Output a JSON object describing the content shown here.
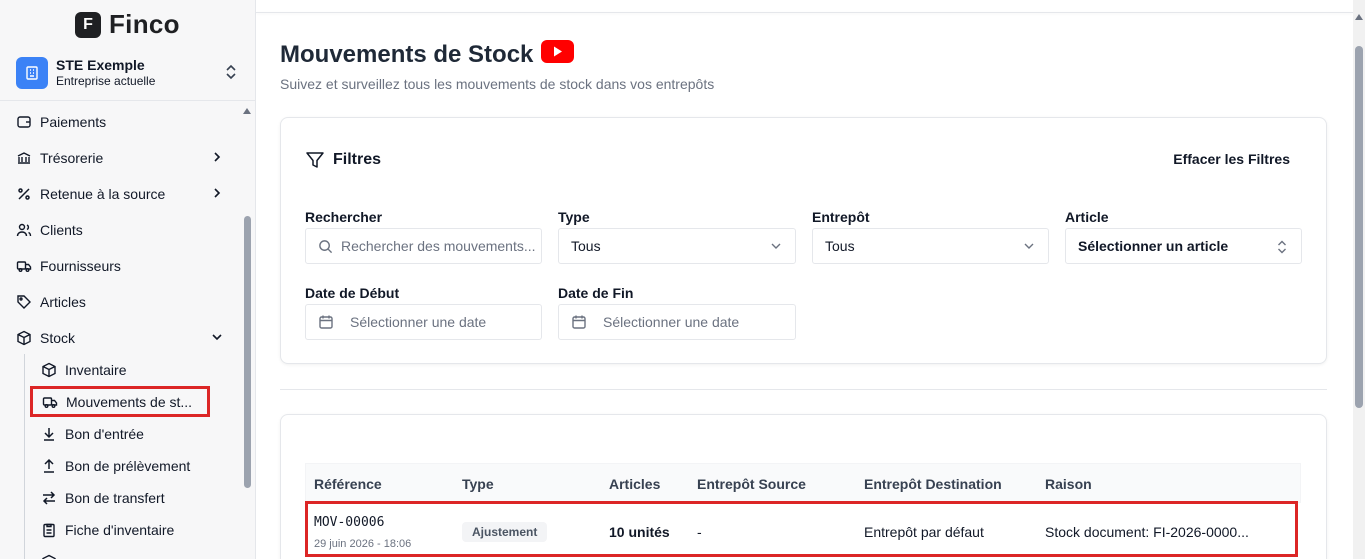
{
  "brand": {
    "logo_letter": "F",
    "name": "Finco"
  },
  "company": {
    "name": "STE Exemple",
    "subtitle": "Entreprise actuelle"
  },
  "sidebar": {
    "items": [
      {
        "label": "Paiements",
        "icon": "wallet-icon"
      },
      {
        "label": "Trésorerie",
        "icon": "bank-icon"
      },
      {
        "label": "Retenue à la source",
        "icon": "percent-icon"
      },
      {
        "label": "Clients",
        "icon": "users-icon"
      },
      {
        "label": "Fournisseurs",
        "icon": "truck-icon"
      },
      {
        "label": "Articles",
        "icon": "tag-icon"
      },
      {
        "label": "Stock",
        "icon": "box-icon"
      }
    ],
    "stock_sub": [
      {
        "label": "Inventaire",
        "icon": "box-icon"
      },
      {
        "label": "Mouvements de st...",
        "icon": "truck-icon"
      },
      {
        "label": "Bon d'entrée",
        "icon": "arrow-down-icon"
      },
      {
        "label": "Bon de prélèvement",
        "icon": "arrow-up-icon"
      },
      {
        "label": "Bon de transfert",
        "icon": "transfer-icon"
      },
      {
        "label": "Fiche d'inventaire",
        "icon": "clipboard-icon"
      }
    ]
  },
  "page": {
    "title": "Mouvements de Stock",
    "subtitle": "Suivez et surveillez tous les mouvements de stock dans vos entrepôts"
  },
  "filters": {
    "title": "Filtres",
    "clear_label": "Effacer les Filtres",
    "search": {
      "label": "Rechercher",
      "placeholder": "Rechercher des mouvements..."
    },
    "type": {
      "label": "Type",
      "value": "Tous"
    },
    "warehouse": {
      "label": "Entrepôt",
      "value": "Tous"
    },
    "article": {
      "label": "Article",
      "value": "Sélectionner un article"
    },
    "start_date": {
      "label": "Date de Début",
      "placeholder": "Sélectionner une date"
    },
    "end_date": {
      "label": "Date de Fin",
      "placeholder": "Sélectionner une date"
    }
  },
  "table": {
    "headers": [
      "Référence",
      "Type",
      "Articles",
      "Entrepôt Source",
      "Entrepôt Destination",
      "Raison"
    ],
    "rows": [
      {
        "reference": "MOV-00006",
        "date": "29 juin 2026 - 18:06",
        "type": "Ajustement",
        "articles": "10 unités",
        "source": "-",
        "destination": "Entrepôt par défaut",
        "reason": "Stock document: FI-2026-0000..."
      }
    ]
  },
  "colors": {
    "accent_red": "#dc2626",
    "company_blue": "#3b82f6",
    "youtube_red": "#ff0000"
  }
}
